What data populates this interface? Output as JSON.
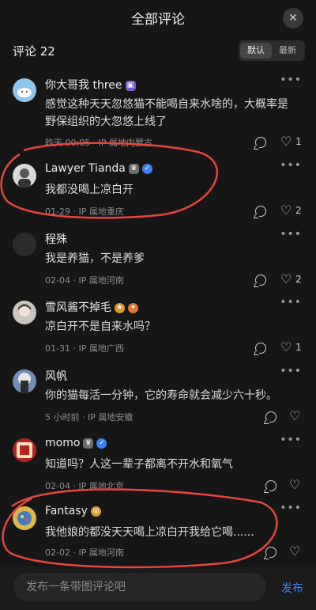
{
  "header": {
    "title": "全部评论",
    "close_icon": "close-icon"
  },
  "subhead": {
    "count_label": "评论 22",
    "sort_default": "默认",
    "sort_latest": "最新"
  },
  "comments": [
    {
      "name": "你大哥我 three",
      "text": "感觉这种天天忽悠猫不能喝自来水啥的，大概率是野保组织的大忽悠上线了",
      "meta": "昨天 00:05 · IP 属地内蒙古",
      "likes": "1",
      "avatar_color": "#8fc6ee"
    },
    {
      "name": "Lawyer Tianda",
      "text": "我都没喝上凉白开",
      "meta": "01-29 · IP 属地重庆",
      "likes": "2",
      "avatar_color": "#d8d8d8"
    },
    {
      "name": "程殊",
      "text": "我是养猫，不是养爹",
      "meta": "02-04 · IP 属地河南",
      "likes": "2",
      "avatar_color": "#2b2b2b"
    },
    {
      "name": "雪风酱不掉毛",
      "text": "凉白开不是自来水吗？",
      "meta": "01-31 · IP 属地广西",
      "likes": "1",
      "avatar_color": "#c9c4bd"
    },
    {
      "name": "风帆",
      "text": "你的猫每活一分钟，它的寿命就会减少六十秒。",
      "meta": "5 小时前 · IP 属地安徽",
      "likes": "",
      "avatar_color": "#6f8fb8"
    },
    {
      "name": "momo",
      "text": "知道吗？人这一辈子都离不开水和氧气",
      "meta": "02-04 · IP 属地北京",
      "likes": "",
      "avatar_color": "#b32323"
    },
    {
      "name": "Fantasy",
      "text": "我他娘的都没天天喝上凉白开我给它喝......",
      "meta": "02-02 · IP 属地河南",
      "likes": "",
      "avatar_color": "#e0b54a"
    }
  ],
  "input": {
    "placeholder": "发布一条带图评论吧",
    "publish_label": "发布"
  },
  "colors": {
    "background": "#161616",
    "accent": "#3b82f6",
    "annotation": "#e8453c"
  }
}
